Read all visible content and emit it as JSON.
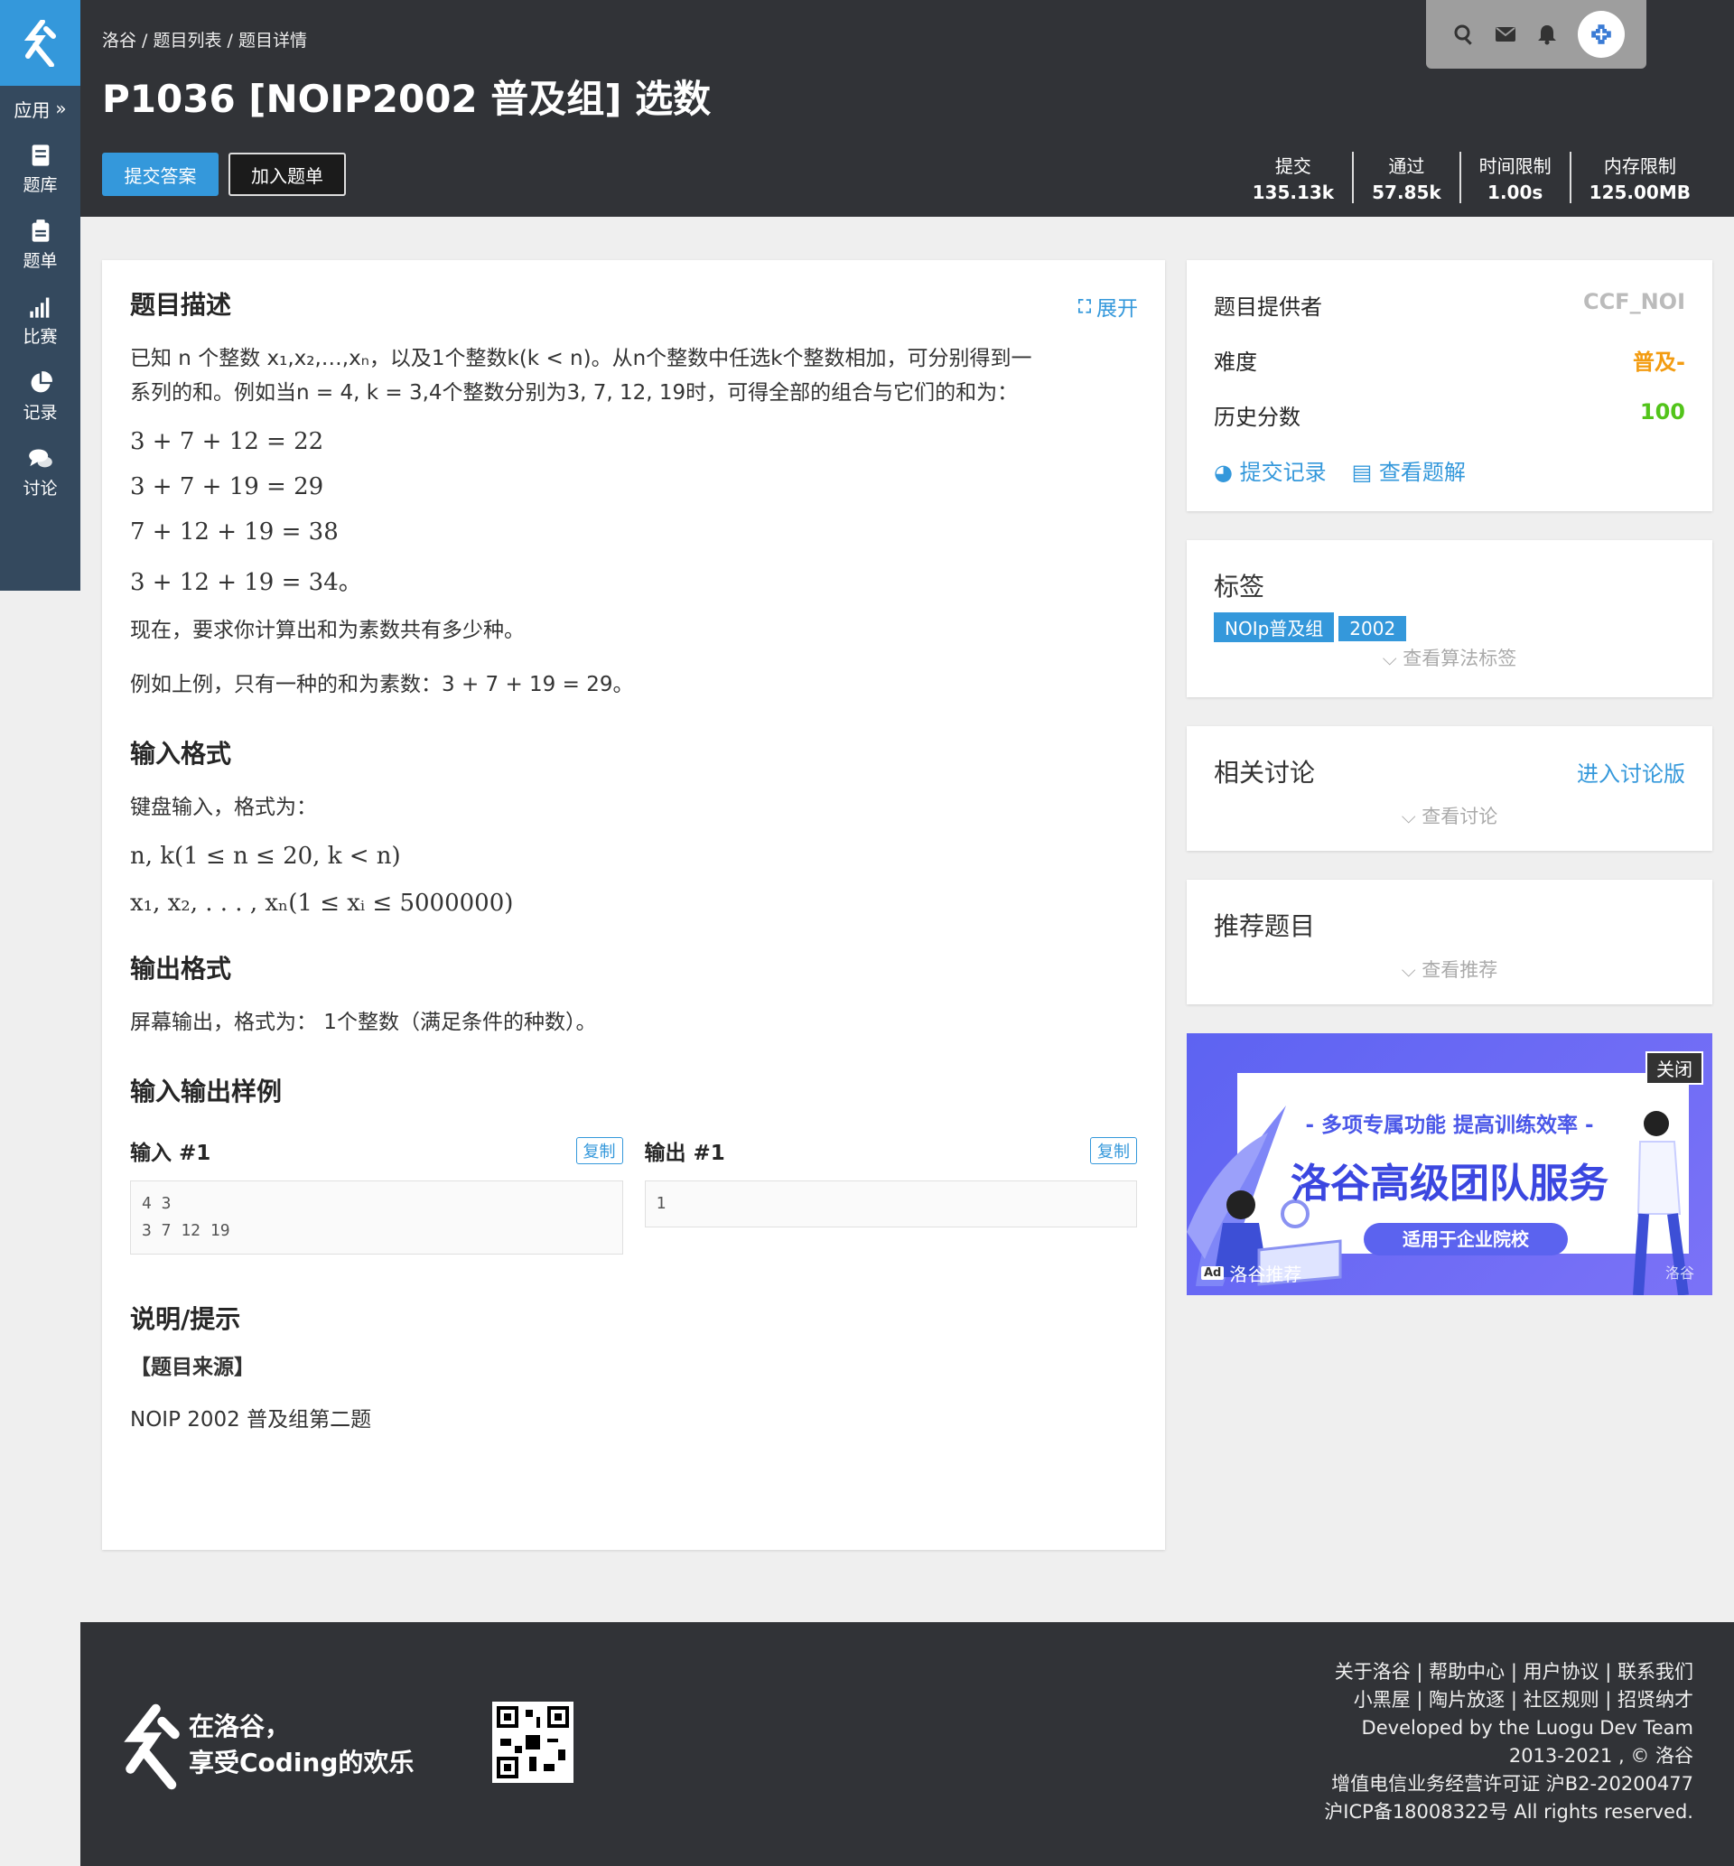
{
  "sidebar": {
    "app_label": "应用",
    "items": [
      {
        "label": "题库",
        "icon": "book-icon"
      },
      {
        "label": "题单",
        "icon": "clipboard-icon"
      },
      {
        "label": "比赛",
        "icon": "bar-chart-icon"
      },
      {
        "label": "记录",
        "icon": "pie-chart-icon"
      },
      {
        "label": "讨论",
        "icon": "comments-icon"
      }
    ]
  },
  "header": {
    "breadcrumb": "洛谷 / 题目列表 / 题目详情",
    "title": "P1036 [NOIP2002 普及组] 选数",
    "submit_label": "提交答案",
    "add_label": "加入题单",
    "stats": [
      {
        "label": "提交",
        "value": "135.13k"
      },
      {
        "label": "通过",
        "value": "57.85k"
      },
      {
        "label": "时间限制",
        "value": "1.00s"
      },
      {
        "label": "内存限制",
        "value": "125.00MB"
      }
    ]
  },
  "problem": {
    "desc_title": "题目描述",
    "expand_label": "展开",
    "desc_line1": "已知 n 个整数 x₁,x₂,…,xₙ，以及1个整数k(k < n)。从n个整数中任选k个整数相加，可分别得到一",
    "desc_line2": "系列的和。例如当n = 4, k = 3,4个整数分别为3, 7, 12, 19时，可得全部的组合与它们的和为：",
    "eq1": "3 + 7 + 12 = 22",
    "eq2": "3 + 7 + 19 = 29",
    "eq3": "7 + 12 + 19 = 38",
    "eq4": "3 + 12 + 19 = 34。",
    "desc_q": "现在，要求你计算出和为素数共有多少种。",
    "desc_ex": "例如上例，只有一种的和为素数：3 + 7 + 19 = 29。",
    "input_title": "输入格式",
    "input_text": "键盘输入，格式为：",
    "input_eq1": "n, k(1 ≤ n ≤ 20, k < n)",
    "input_eq2": "x₁, x₂, . . . , xₙ(1 ≤ xᵢ ≤ 5000000)",
    "output_title": "输出格式",
    "output_text": "屏幕输出，格式为： 1个整数（满足条件的种数）。",
    "sample_title": "输入输出样例",
    "input_sample_label": "输入 #1",
    "output_sample_label": "输出 #1",
    "copy_label": "复制",
    "input_sample": "4 3\n3 7 12 19",
    "output_sample": "1",
    "hint_title": "说明/提示",
    "source_label": "【题目来源】",
    "source_text": "NOIP 2002 普及组第二题"
  },
  "info": {
    "provider_label": "题目提供者",
    "provider_value": "CCF_NOI",
    "difficulty_label": "难度",
    "difficulty_value": "普及-",
    "history_label": "历史分数",
    "history_value": "100",
    "records_link": "提交记录",
    "solutions_link": "查看题解",
    "difficulty_color": "#f39c11",
    "history_color": "#52c41a"
  },
  "tags": {
    "title": "标签",
    "items": [
      "NOIp普及组",
      "2002"
    ],
    "more": "查看算法标签"
  },
  "discuss": {
    "title": "相关讨论",
    "enter": "进入讨论版",
    "more": "查看讨论"
  },
  "recommend": {
    "title": "推荐题目",
    "more": "查看推荐"
  },
  "ad": {
    "close": "关闭",
    "subtitle": "- 多项专属功能  提高训练效率 -",
    "title": "洛谷高级团队服务",
    "button": "适用于企业院校",
    "ad_badge": "Ad",
    "ad_source": "洛谷推荐",
    "watermark": "洛谷"
  },
  "footer": {
    "slogan1": "在洛谷，",
    "slogan2": "享受Coding的欢乐",
    "links1": "关于洛谷 | 帮助中心 | 用户协议 | 联系我们",
    "links2": "小黑屋 | 陶片放逐 | 社区规则 | 招贤纳才",
    "dev": "Developed by the Luogu Dev Team",
    "copy": "2013-2021 , © 洛谷",
    "license": "增值电信业务经营许可证 沪B2-20200477",
    "icp": "沪ICP备18008322号 All rights reserved."
  }
}
